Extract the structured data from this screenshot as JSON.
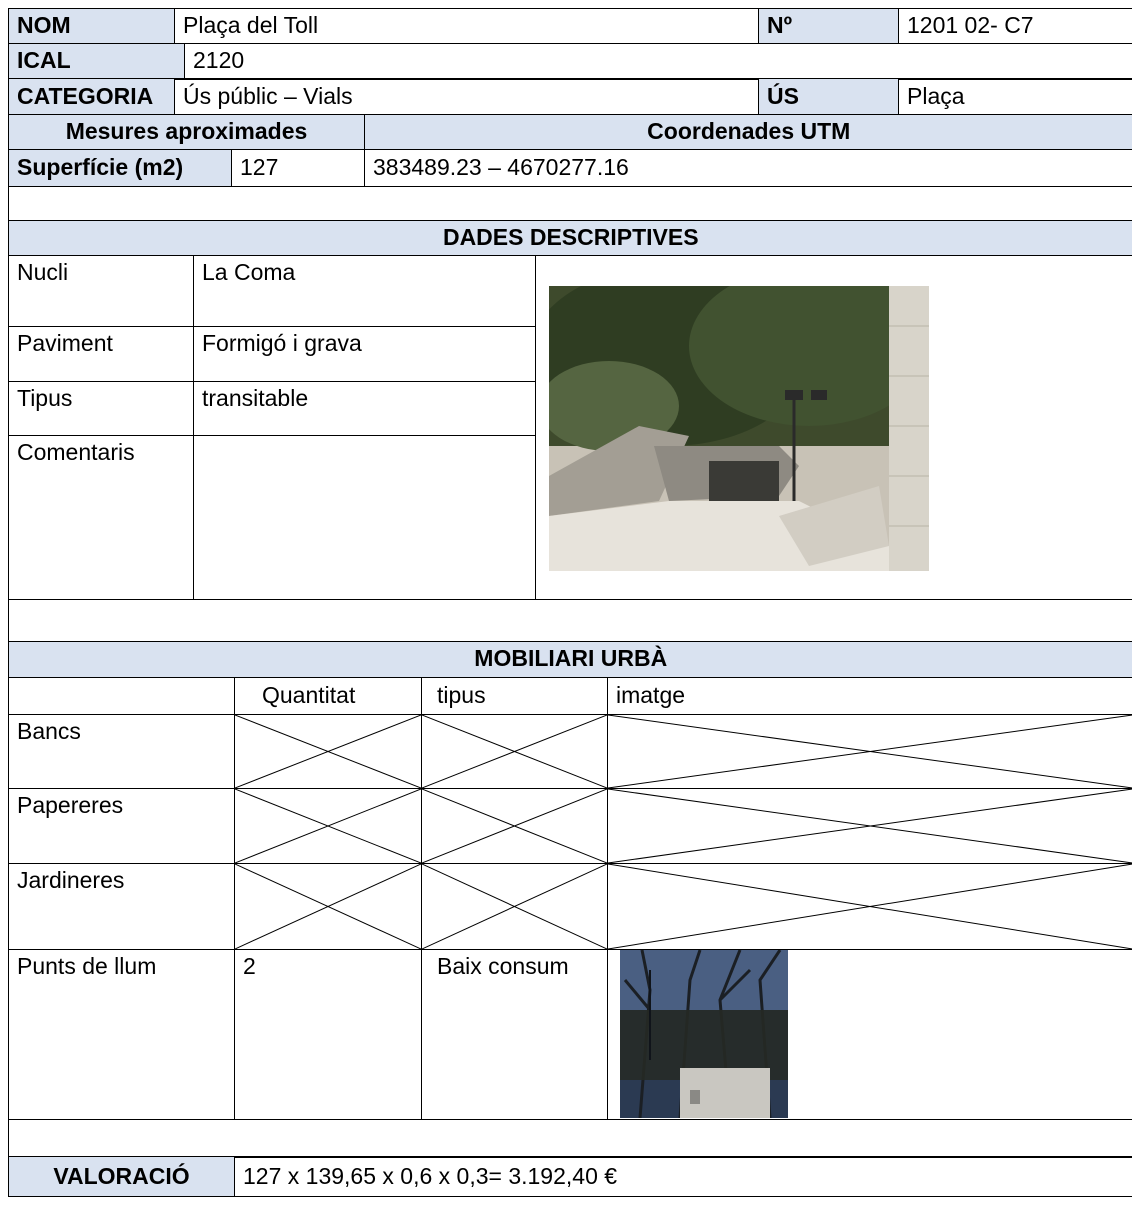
{
  "header": {
    "nom_label": "NOM",
    "nom_value": "Plaça del Toll",
    "num_label": "Nº",
    "num_value": "1201 02- C7",
    "ical_label": "ICAL",
    "ical_value": "2120",
    "categoria_label": "CATEGORIA",
    "categoria_value": "Ús públic – Vials",
    "us_label": "ÚS",
    "us_value": "Plaça"
  },
  "mesures": {
    "title": "Mesures aproximades",
    "coords_title": "Coordenades UTM",
    "superficie_label": "Superfície (m2)",
    "superficie_value": "127",
    "coords_value": "383489.23 – 4670277.16"
  },
  "descriptives": {
    "title": "DADES DESCRIPTIVES",
    "rows": [
      {
        "label": "Nucli",
        "value": "La Coma"
      },
      {
        "label": "Paviment",
        "value": "Formigó i grava"
      },
      {
        "label": "Tipus",
        "value": "transitable"
      },
      {
        "label": "Comentaris",
        "value": ""
      }
    ]
  },
  "mobiliari": {
    "title": "MOBILIARI URBÀ",
    "columns": [
      "",
      "Quantitat",
      "tipus",
      "imatge"
    ],
    "rows": [
      {
        "label": "Bancs"
      },
      {
        "label": "Papereres"
      },
      {
        "label": "Jardineres"
      },
      {
        "label": "Punts de llum",
        "quantitat": "2",
        "tipus": "Baix consum"
      }
    ]
  },
  "valoracio": {
    "label": "VALORACIÓ",
    "value": "127 x 139,65 x 0,6 x 0,3= 3.192,40 €"
  }
}
